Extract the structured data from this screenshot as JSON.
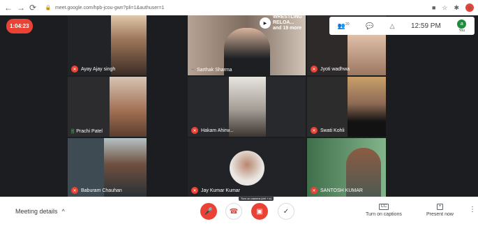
{
  "browser": {
    "url": "meet.google.com/hpb-jcou-gwn?pli=1&authuser=1",
    "back_icon": "arrow-left-icon",
    "forward_icon": "arrow-right-icon",
    "reload_icon": "reload-icon",
    "right_icons": [
      "camera-icon",
      "star-icon",
      "puzzle-icon"
    ],
    "profile_letter": "e"
  },
  "meeting": {
    "timer": "1:04:23",
    "participants_count": "20",
    "clock": "12:59 PM",
    "you_label": "You",
    "you_letter": "a",
    "presenting": {
      "line1": "WRESTLING RELOA...",
      "line2": "and 19 more"
    }
  },
  "participants": [
    {
      "name": "Ayay Ajay singh",
      "mic": "off",
      "bg": "#2d2b2a"
    },
    {
      "name": "Sarthak Sharma",
      "mic": "none",
      "bg": "#7a6a5e"
    },
    {
      "name": "Jyoti wadhwa",
      "mic": "off",
      "bg": "#3a3030"
    },
    {
      "name": "Prachi Patel",
      "mic": "on",
      "bg": "#2c2b2e"
    },
    {
      "name": "Hakam Ahirw...",
      "mic": "off",
      "bg": "#28292d"
    },
    {
      "name": "Swati Kohli",
      "mic": "off",
      "bg": "#3c3a35"
    },
    {
      "name": "Baburam Chauhan",
      "mic": "off",
      "bg": "#4b5a61"
    },
    {
      "name": "Jay Kumar Kumar",
      "mic": "off",
      "bg": "#222327"
    },
    {
      "name": "SANTOSH KUMAR",
      "mic": "off",
      "bg": "#4d7a55"
    }
  ],
  "controls": {
    "meeting_details": "Meeting details",
    "tooltip": "Turn on camera (ctrl + e)",
    "captions": "Turn on captions",
    "captions_icon": "CC",
    "present": "Present now",
    "present_icon": "+"
  }
}
